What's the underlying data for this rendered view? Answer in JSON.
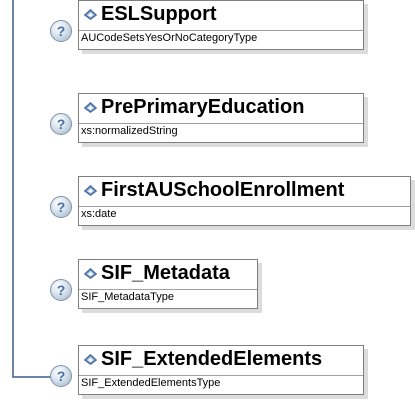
{
  "elements": [
    {
      "name": "ESLSupport",
      "type": "AUCodeSetsYesOrNoCategoryType"
    },
    {
      "name": "PrePrimaryEducation",
      "type": "xs:normalizedString"
    },
    {
      "name": "FirstAUSchoolEnrollment",
      "type": "xs:date"
    },
    {
      "name": "SIF_Metadata",
      "type": "SIF_MetadataType"
    },
    {
      "name": "SIF_ExtendedElements",
      "type": "SIF_ExtendedElementsType"
    }
  ],
  "help_glyph": "?",
  "icons": {
    "help": "help-icon",
    "element": "element-diamond-icon"
  },
  "colors": {
    "connector": "#3b5b8c",
    "box_border": "#7f7f7f",
    "icon_fill": "#4a6fa5",
    "icon_light": "#a9c3e0"
  }
}
